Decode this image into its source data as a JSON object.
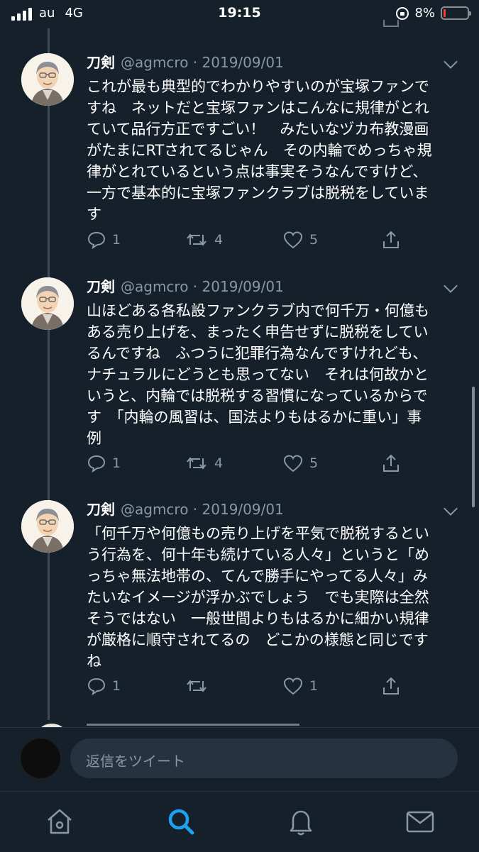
{
  "status_bar": {
    "carrier": "au",
    "network": "4G",
    "time": "19:15",
    "battery_percent": "8%"
  },
  "tweets": [
    {
      "name": "刀剣",
      "handle": "@agmcro · 2019/09/01",
      "text": "これが最も典型的でわかりやすいのが宝塚ファンで\nすね　ネットだと宝塚ファンはこんなに規律がとれ\nていて品行方正ですごい！　みたいなヅカ布教漫画\nがたまにRTされてるじゃん　その内輪でめっちゃ規\n律がとれているという点は事実そうなんですけど、\n一方で基本的に宝塚ファンクラブは脱税をしていま\nす",
      "replies": "1",
      "retweets": "4",
      "likes": "5"
    },
    {
      "name": "刀剣",
      "handle": "@agmcro · 2019/09/01",
      "text": "山ほどある各私設ファンクラブ内で何千万・何億も\nある売り上げを、まったく申告せずに脱税をしてい\nるんですね　ふつうに犯罪行為なんですけれども、\nナチュラルにどうとも思ってない　それは何故かと\nいうと、内輪では脱税する習慣になっているからで\nす　「内輪の風習は、国法よりもはるかに重い」事\n例",
      "replies": "1",
      "retweets": "4",
      "likes": "5"
    },
    {
      "name": "刀剣",
      "handle": "@agmcro · 2019/09/01",
      "text": "「何千万や何億もの売り上げを平気で脱税するとい\nう行為を、何十年も続けている人々」というと「め\nっちゃ無法地帯の、てんで勝手にやってる人々」み\nたいなイメージが浮かぶでしょう　でも実際は全然\nそうではない　一般世間よりもはるかに細かい規律\nが厳格に順守されてるの　どこかの様態と同じです\nね",
      "replies": "1",
      "retweets": "",
      "likes": "1"
    }
  ],
  "reply_bar": {
    "placeholder": "返信をツイート"
  },
  "tabbar": {
    "items": [
      {
        "icon": "home-icon"
      },
      {
        "icon": "search-icon",
        "active": true
      },
      {
        "icon": "bell-icon"
      },
      {
        "icon": "mail-icon"
      }
    ]
  },
  "colors": {
    "background": "#15202b",
    "secondary_text": "#8899a6",
    "accent": "#1da1f2",
    "battery_low": "#ff3b30"
  }
}
